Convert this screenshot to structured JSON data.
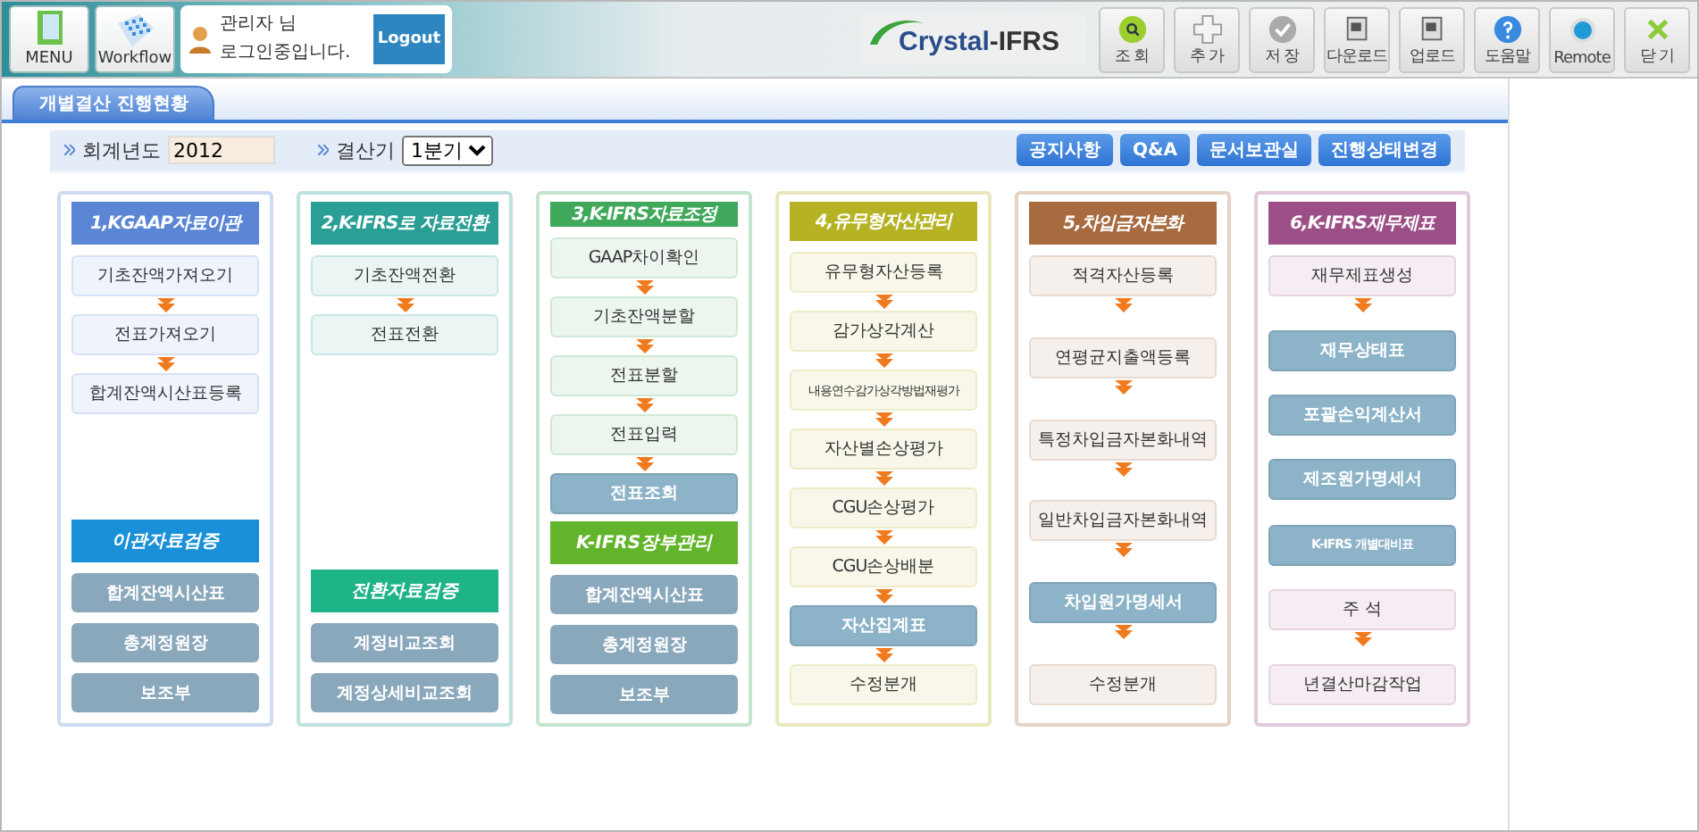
{
  "header": {
    "menu_buttons": [
      {
        "kind": "menu",
        "label": "MENU"
      },
      {
        "kind": "workflow",
        "label": "Workflow"
      }
    ],
    "login": {
      "user": "관리자 님",
      "status": "로그인중입니다.",
      "logout": "Logout"
    },
    "logo": {
      "part_1": "Crystal",
      "part_2": "-IFRS"
    },
    "toolbar": [
      {
        "kind": "search",
        "label": "조 회"
      },
      {
        "kind": "add",
        "label": "추 가"
      },
      {
        "kind": "save",
        "label": "저 장"
      },
      {
        "kind": "download",
        "label": "다운로드"
      },
      {
        "kind": "upload",
        "label": "업로드"
      },
      {
        "kind": "help",
        "label": "도움말"
      },
      {
        "kind": "remote",
        "label": "Remote"
      },
      {
        "kind": "close",
        "label": "닫 기"
      }
    ]
  },
  "tabs": [
    {
      "label": "개별결산 진행현황",
      "selected": true
    }
  ],
  "filters": {
    "year_label": "회계년도",
    "year_value": "2012",
    "period_label": "결산기",
    "period_value": "1분기"
  },
  "action_buttons": [
    "공지사항",
    "Q&A",
    "문서보관실",
    "진행상태변경"
  ],
  "columns": [
    {
      "title": "1,KGAAP자료이관",
      "color": "#5b86d6",
      "steps": [
        {
          "label": "기초잔액가져오기",
          "kind": "light",
          "arrow_after": true
        },
        {
          "label": "전표가져오기",
          "kind": "light",
          "arrow_after": true
        },
        {
          "label": "합계잔액시산표등록",
          "kind": "light",
          "arrow_after": false
        }
      ],
      "section": {
        "title": "이관자료검증",
        "color": "#1a90d8",
        "items": [
          "합계잔액시산표",
          "총계정원장",
          "보조부"
        ]
      }
    },
    {
      "title": "2,K-IFRS로 자료전환",
      "color": "#2a9f95",
      "steps": [
        {
          "label": "기초잔액전환",
          "kind": "light",
          "arrow_after": true
        },
        {
          "label": "전표전환",
          "kind": "light",
          "arrow_after": false
        }
      ],
      "section": {
        "title": "전환자료검증",
        "color": "#1fb488",
        "items": [
          "계정비교조회",
          "계정상세비교조회"
        ]
      }
    },
    {
      "title": "3,K-IFRS자료조정",
      "color": "#3fa85a",
      "steps": [
        {
          "label": "GAAP차이확인",
          "kind": "light",
          "arrow_after": true
        },
        {
          "label": "기초잔액분할",
          "kind": "light",
          "arrow_after": true
        },
        {
          "label": "전표분할",
          "kind": "light",
          "arrow_after": true
        },
        {
          "label": "전표입력",
          "kind": "light",
          "arrow_after": true
        },
        {
          "label": "전표조회",
          "kind": "dark",
          "arrow_after": false
        }
      ],
      "section": {
        "title": "K-IFRS장부관리",
        "color": "#62b42a",
        "items": [
          "합계잔액시산표",
          "총계정원장",
          "보조부"
        ]
      }
    },
    {
      "title": "4,유무형자산관리",
      "color": "#b5b324",
      "steps": [
        {
          "label": "유무형자산등록",
          "kind": "light",
          "arrow_after": true
        },
        {
          "label": "감가상각계산",
          "kind": "light",
          "arrow_after": true
        },
        {
          "label": "내용연수감가상각방법재평가",
          "kind": "light",
          "arrow_after": true
        },
        {
          "label": "자산별손상평가",
          "kind": "light",
          "arrow_after": true
        },
        {
          "label": "CGU손상평가",
          "kind": "light",
          "arrow_after": true
        },
        {
          "label": "CGU손상배분",
          "kind": "light",
          "arrow_after": true
        },
        {
          "label": "자산집계표",
          "kind": "dark",
          "arrow_after": true
        },
        {
          "label": "수정분개",
          "kind": "light",
          "arrow_after": false
        }
      ]
    },
    {
      "title": "5,차입금자본화",
      "color": "#a86b40",
      "steps": [
        {
          "label": "적격자산등록",
          "kind": "light",
          "arrow_after": true
        },
        {
          "label": "연평균지출액등록",
          "kind": "light",
          "arrow_after": true
        },
        {
          "label": "특정차입금자본화내역",
          "kind": "light",
          "arrow_after": true
        },
        {
          "label": "일반차입금자본화내역",
          "kind": "light",
          "arrow_after": true
        },
        {
          "label": "차입원가명세서",
          "kind": "dark",
          "arrow_after": true
        },
        {
          "label": "수정분개",
          "kind": "light",
          "arrow_after": false
        }
      ]
    },
    {
      "title": "6,K-IFRS재무제표",
      "color": "#9c4f86",
      "steps": [
        {
          "label": "재무제표생성",
          "kind": "light",
          "arrow_after": true
        },
        {
          "label": "재무상태표",
          "kind": "dark",
          "arrow_after": false
        },
        {
          "label": "포괄손익계산서",
          "kind": "dark",
          "arrow_after": false
        },
        {
          "label": "제조원가명세서",
          "kind": "dark",
          "arrow_after": false
        },
        {
          "label": "K-IFRS 개별대비표",
          "kind": "dark",
          "arrow_after": false
        },
        {
          "label": "주 석",
          "kind": "light",
          "arrow_after": true
        },
        {
          "label": "년결산마감작업",
          "kind": "light",
          "arrow_after": false
        }
      ]
    }
  ]
}
